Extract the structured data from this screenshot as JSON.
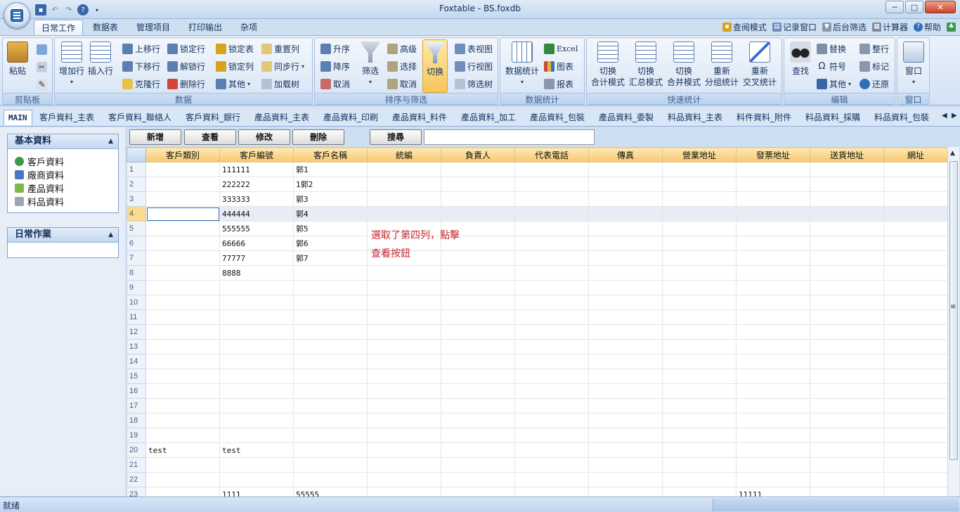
{
  "window": {
    "title": "Foxtable - BS.foxdb",
    "min": "─",
    "max": "□",
    "close": "✕"
  },
  "ribbon_tabs": [
    "日常工作",
    "数据表",
    "管理项目",
    "打印输出",
    "杂项"
  ],
  "top_links": [
    "查阅模式",
    "记录窗口",
    "后台筛选",
    "计算器",
    "帮助"
  ],
  "groups": {
    "clipboard": {
      "label": "剪贴板",
      "paste": "粘贴"
    },
    "data": {
      "label": "数据",
      "add_row": "增加行",
      "insert_row": "插入行",
      "items": [
        "上移行",
        "下移行",
        "克隆行",
        "锁定行",
        "解锁行",
        "删除行",
        "锁定表",
        "锁定列",
        "其他",
        "重置列",
        "同步行",
        "加载树"
      ]
    },
    "sort": {
      "label": "排序与筛选",
      "asc": "升序",
      "desc": "降序",
      "cancel": "取消",
      "filter": "筛选",
      "advanced": "高级",
      "select": "选择",
      "cancel2": "取消",
      "toggle": "切换",
      "table_view": "表视图",
      "row_view": "行视图",
      "filter_tree": "筛选树"
    },
    "stats": {
      "label": "数据统计",
      "stats": "数据统计",
      "excel": "Excel",
      "chart": "图表",
      "report": "报表"
    },
    "quick": {
      "label": "快速统计",
      "items": [
        [
          "切换",
          "合计模式"
        ],
        [
          "切换",
          "汇总模式"
        ],
        [
          "切换",
          "合并模式"
        ],
        [
          "重新",
          "分组统计"
        ],
        [
          "重新",
          "交叉统计"
        ]
      ]
    },
    "edit": {
      "label": "编辑",
      "find": "查找",
      "replace": "替换",
      "symbol": "符号",
      "other": "其他",
      "arrange": "整行",
      "mark": "标记",
      "restore": "还原"
    },
    "window": {
      "label": "窗口",
      "window": "窗口"
    }
  },
  "sheet_tabs": [
    "MAIN",
    "客戶資料_主表",
    "客戶資料_聯絡人",
    "客戶資料_銀行",
    "產品資料_主表",
    "產品資料_印刷",
    "產品資料_料件",
    "產品資料_加工",
    "產品資料_包裝",
    "產品資料_委製",
    "料品資料_主表",
    "料件資料_附件",
    "料品資料_採購",
    "料品資料_包裝"
  ],
  "left_panels": [
    {
      "title": "基本資料",
      "items": [
        "客戶資料",
        "廠商資料",
        "產品資料",
        "料品資料"
      ]
    },
    {
      "title": "日常作業",
      "items": []
    }
  ],
  "action_buttons": [
    "新增",
    "查看",
    "修改",
    "刪除",
    "搜尋"
  ],
  "search": {
    "value": ""
  },
  "grid": {
    "columns": [
      "客戶類別",
      "客戶編號",
      "客戶名稱",
      "統編",
      "負責人",
      "代表電話",
      "傳真",
      "營業地址",
      "發票地址",
      "送貨地址",
      "網址"
    ],
    "rows": [
      [
        "1",
        "",
        "111111",
        "郭1",
        "",
        "",
        "",
        "",
        "",
        "",
        "",
        ""
      ],
      [
        "2",
        "",
        "222222",
        "1郭2",
        "",
        "",
        "",
        "",
        "",
        "",
        "",
        ""
      ],
      [
        "3",
        "",
        "333333",
        "郭3",
        "",
        "",
        "",
        "",
        "",
        "",
        "",
        ""
      ],
      [
        "4",
        "",
        "444444",
        "郭4",
        "",
        "",
        "",
        "",
        "",
        "",
        "",
        ""
      ],
      [
        "5",
        "",
        "555555",
        "郭5",
        "",
        "",
        "",
        "",
        "",
        "",
        "",
        ""
      ],
      [
        "6",
        "",
        "66666",
        "郭6",
        "",
        "",
        "",
        "",
        "",
        "",
        "",
        ""
      ],
      [
        "7",
        "",
        "77777",
        "郭7",
        "",
        "",
        "",
        "",
        "",
        "",
        "",
        ""
      ],
      [
        "8",
        "",
        "8888",
        "",
        "",
        "",
        "",
        "",
        "",
        "",
        "",
        ""
      ],
      [
        "9",
        "",
        "",
        "",
        "",
        "",
        "",
        "",
        "",
        "",
        "",
        ""
      ],
      [
        "10",
        "",
        "",
        "",
        "",
        "",
        "",
        "",
        "",
        "",
        "",
        ""
      ],
      [
        "11",
        "",
        "",
        "",
        "",
        "",
        "",
        "",
        "",
        "",
        "",
        ""
      ],
      [
        "12",
        "",
        "",
        "",
        "",
        "",
        "",
        "",
        "",
        "",
        "",
        ""
      ],
      [
        "13",
        "",
        "",
        "",
        "",
        "",
        "",
        "",
        "",
        "",
        "",
        ""
      ],
      [
        "14",
        "",
        "",
        "",
        "",
        "",
        "",
        "",
        "",
        "",
        "",
        ""
      ],
      [
        "15",
        "",
        "",
        "",
        "",
        "",
        "",
        "",
        "",
        "",
        "",
        ""
      ],
      [
        "16",
        "",
        "",
        "",
        "",
        "",
        "",
        "",
        "",
        "",
        "",
        ""
      ],
      [
        "17",
        "",
        "",
        "",
        "",
        "",
        "",
        "",
        "",
        "",
        "",
        ""
      ],
      [
        "18",
        "",
        "",
        "",
        "",
        "",
        "",
        "",
        "",
        "",
        "",
        ""
      ],
      [
        "19",
        "",
        "",
        "",
        "",
        "",
        "",
        "",
        "",
        "",
        "",
        ""
      ],
      [
        "20",
        "test",
        "test",
        "",
        "",
        "",
        "",
        "",
        "",
        "",
        "",
        ""
      ],
      [
        "21",
        "",
        "",
        "",
        "",
        "",
        "",
        "",
        "",
        "",
        "",
        ""
      ],
      [
        "22",
        "",
        "",
        "",
        "",
        "",
        "",
        "",
        "",
        "",
        "",
        ""
      ],
      [
        "23",
        "",
        "1111",
        "55555",
        "",
        "",
        "",
        "",
        "",
        "11111",
        "",
        ""
      ]
    ],
    "selected_row": 4
  },
  "note_lines": [
    "選取了第四列，點擊",
    "查看按鈕"
  ],
  "status": "就绪",
  "colors": {
    "accent": "#2f6fb8",
    "header_orange": "#f7c86d",
    "note_red": "#c4262e",
    "selected_row_marker": "#fbd98e"
  }
}
